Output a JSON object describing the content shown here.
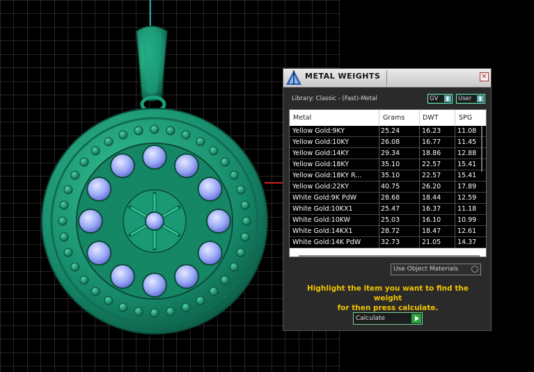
{
  "window": {
    "title": "METAL WEIGHTS",
    "close_glyph": "✕"
  },
  "library": {
    "label": "Library: Classic - (Fast)-Metal"
  },
  "selectors": {
    "gv": "GV",
    "user": "User",
    "knob_glyph": "▮"
  },
  "table": {
    "columns": [
      "Metal",
      "Grams",
      "DWT",
      "SPG"
    ],
    "rows": [
      [
        "Yellow Gold:9KY",
        "25.24",
        "16.23",
        "11.08"
      ],
      [
        "Yellow Gold:10KY",
        "26.08",
        "16.77",
        "11.45"
      ],
      [
        "Yellow Gold:14KY",
        "29.34",
        "18.86",
        "12.88"
      ],
      [
        "Yellow Gold:18KY",
        "35.10",
        "22.57",
        "15.41"
      ],
      [
        "Yellow Gold:18KY R...",
        "35.10",
        "22.57",
        "15.41"
      ],
      [
        "Yellow Gold:22KY",
        "40.75",
        "26.20",
        "17.89"
      ],
      [
        "White Gold:9K PdW",
        "28.68",
        "18.44",
        "12.59"
      ],
      [
        "White Gold:10KX1",
        "25.47",
        "16.37",
        "11.18"
      ],
      [
        "White Gold:10KW",
        "25.03",
        "16.10",
        "10.99"
      ],
      [
        "White Gold:14KX1",
        "28.72",
        "18.47",
        "12.61"
      ],
      [
        "White Gold:14K PdW",
        "32.73",
        "21.05",
        "14.37"
      ]
    ]
  },
  "use_object_materials": {
    "label": "Use Object Materials"
  },
  "instructions": {
    "line1": "Highlight the item you want to find the weight",
    "line2": "for then press calculate."
  },
  "calculate": {
    "label": "Calculate"
  },
  "colors": {
    "pendant": "#1e9e78",
    "gems": "#8c9cf0",
    "accent_text": "#f2c400",
    "grid": "#3a3a3a"
  }
}
